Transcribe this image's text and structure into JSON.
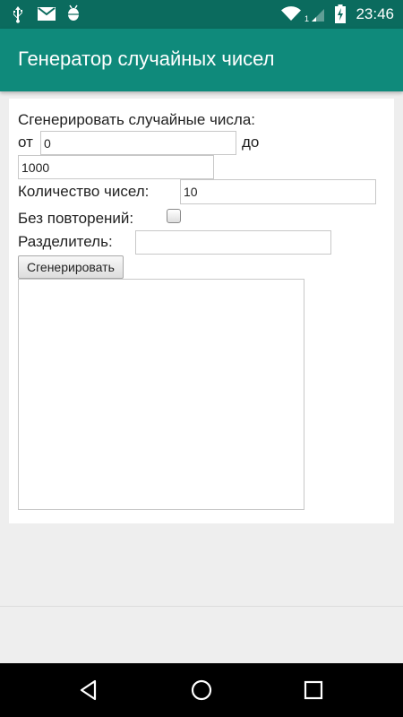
{
  "status_bar": {
    "time": "23:46",
    "icons": [
      "usb-icon",
      "mail-icon",
      "android-debug-icon",
      "wifi-icon",
      "signal-icon",
      "battery-charging-icon"
    ]
  },
  "app_bar": {
    "title": "Генератор случайных чисел"
  },
  "form": {
    "heading": "Сгенерировать случайные числа:",
    "from_label": "от",
    "from_value": "0",
    "to_label": "до",
    "to_value": "1000",
    "count_label": "Количество чисел:",
    "count_value": "10",
    "no_repeat_label": "Без повторений:",
    "no_repeat_checked": false,
    "separator_label": "Разделитель:",
    "separator_value": "",
    "generate_label": "Сгенерировать",
    "result_value": ""
  },
  "nav_bar": {
    "icons": [
      "back-icon",
      "home-icon",
      "recents-icon"
    ]
  },
  "colors": {
    "status_bar": "#0b6b5e",
    "app_bar": "#0f8a7b",
    "background": "#eeeeee",
    "nav_bar": "#000000"
  }
}
